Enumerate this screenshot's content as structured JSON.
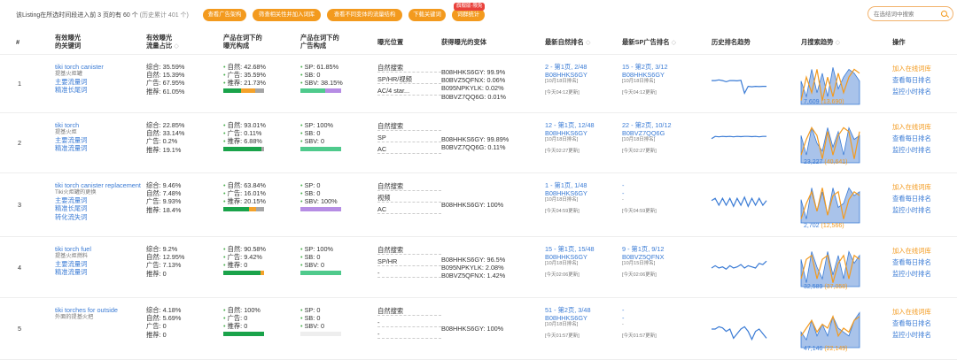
{
  "toolbar": {
    "summary": "该Listing在所选时间段进入前 3 页的有 60 个",
    "history": "(历史累计 401 个)",
    "buttons": [
      "查看广告架构",
      "筛查相关性并加入词库",
      "查看不同变体的流量结构",
      "下载关键词",
      "词群统计"
    ],
    "badge": "旗舰版·限免",
    "search_placeholder": "在选结词中搜索"
  },
  "headers": {
    "num": "#",
    "kw_l1": "有效曝光",
    "kw_l2": "的关键词",
    "share_l1": "有效曝光",
    "share_l2": "流量占比",
    "comp_l1": "产品在词下的",
    "comp_l2": "曝光构成",
    "adcomp_l1": "产品在词下的",
    "adcomp_l2": "广告构成",
    "pos": "曝光位置",
    "var": "获得曝光的变体",
    "nat": "最新自然排名",
    "sp": "最新SP广告排名",
    "trend": "历史排名趋势",
    "month": "月搜索趋势",
    "act": "操作"
  },
  "actions": {
    "add": "加入在线词库",
    "daily": "查看每日排名",
    "hourly": "监控小时排名"
  },
  "colors": {
    "accent": "#f39a1e",
    "link": "#3a7bd5",
    "natural": "#1aa34a",
    "ad": "#f4a22a",
    "rec": "#a6a6a6",
    "sp": "#4fca8c",
    "sb": "#c7c7c7",
    "sbv": "#b68de4"
  },
  "rows": [
    {
      "num": "1",
      "kw": "tiki torch canister",
      "cn": "提基火炬罐",
      "links": [
        "主要流量词",
        "精准长尾词"
      ],
      "share": [
        "综合: 35.59%",
        "自然: 15.39%",
        "广告: 67.95%",
        "推荐: 61.05%"
      ],
      "comp": [
        "自然: 42.68%",
        "广告: 35.59%",
        "推荐: 21.73%"
      ],
      "comp_vals": [
        42.68,
        35.59,
        21.73
      ],
      "adcomp": [
        "SP: 61.85%",
        "SB: 0",
        "SBV: 38.15%"
      ],
      "adcomp_vals": [
        61.85,
        0,
        38.15
      ],
      "pos": [
        "自然搜索",
        "SP/HR/视频",
        "AC/4 star..."
      ],
      "var": [
        "B08HHKS6GY: 99.9%",
        "B0BVZ5QFNX: 0.06%",
        "B095NPKYLK: 0.02%",
        "B0BVZ7QQ6G: 0.01%"
      ],
      "nat": [
        "2 - 第1页, 2/48",
        "B08HHKS6GY",
        "[10月18日排名]",
        "[今天04:12更新]"
      ],
      "sp": [
        "15 - 第2页, 3/12",
        "B08HHKS6GY",
        "[10月18日排名]",
        "[今天04:12更新]"
      ],
      "month_label": [
        "7,609",
        "13,690"
      ]
    },
    {
      "num": "2",
      "kw": "tiki torch",
      "cn": "提基火炬",
      "links": [
        "主要流量词",
        "精准流量词"
      ],
      "share": [
        "综合: 22.85%",
        "自然: 33.14%",
        "广告: 0.2%",
        "推荐: 19.1%"
      ],
      "comp": [
        "自然: 93.01%",
        "广告: 0.11%",
        "推荐: 6.88%"
      ],
      "comp_vals": [
        93.01,
        0.11,
        6.88
      ],
      "adcomp": [
        "SP: 100%",
        "SB: 0",
        "SBV: 0"
      ],
      "adcomp_vals": [
        100,
        0,
        0
      ],
      "pos": [
        "自然搜索",
        "SP",
        "AC"
      ],
      "var": [
        "B08HHKS6GY: 99.89%",
        "B0BVZ7QQ6G: 0.11%"
      ],
      "nat": [
        "12 - 第1页, 12/48",
        "B08HHKS6GY",
        "[10月18日排名]",
        "[今天02:27更新]"
      ],
      "sp": [
        "22 - 第2页, 10/12",
        "B0BVZ7QQ6G",
        "[10月18日排名]",
        "[今天02:27更新]"
      ],
      "month_label": [
        "23,227",
        "40,641"
      ]
    },
    {
      "num": "3",
      "kw": "tiki torch canister replacement",
      "cn": "Tiki火炬罐的更换",
      "links": [
        "主要流量词",
        "精准长尾词",
        "转化流失词"
      ],
      "share": [
        "综合: 9.46%",
        "自然: 7.48%",
        "广告: 9.93%",
        "推荐: 18.4%"
      ],
      "comp": [
        "自然: 63.84%",
        "广告: 16.01%",
        "推荐: 20.15%"
      ],
      "comp_vals": [
        63.84,
        16.01,
        20.15
      ],
      "adcomp": [
        "SP: 0",
        "SB: 0",
        "SBV: 100%"
      ],
      "adcomp_vals": [
        0,
        0,
        100
      ],
      "pos": [
        "自然搜索",
        "视频",
        "AC"
      ],
      "var": [
        "B08HHKS6GY: 100%"
      ],
      "nat": [
        "1 - 第1页, 1/48",
        "B08HHKS6GY",
        "[10月18日排名]",
        "[今天04:59更新]"
      ],
      "sp": [
        "-",
        "-",
        "-",
        "[今天04:59更新]"
      ],
      "month_label": [
        "2,702",
        "12,566"
      ]
    },
    {
      "num": "4",
      "kw": "tiki torch fuel",
      "cn": "提基火炬燃料",
      "links": [
        "主要流量词",
        "精准流量词"
      ],
      "share": [
        "综合: 9.2%",
        "自然: 12.95%",
        "广告: 7.13%",
        "推荐: 0"
      ],
      "comp": [
        "自然: 90.58%",
        "广告: 9.42%",
        "推荐: 0"
      ],
      "comp_vals": [
        90.58,
        9.42,
        0
      ],
      "adcomp": [
        "SP: 100%",
        "SB: 0",
        "SBV: 0"
      ],
      "adcomp_vals": [
        100,
        0,
        0
      ],
      "pos": [
        "自然搜索",
        "SP/HR",
        "-"
      ],
      "var": [
        "B08HHKS6GY: 96.5%",
        "B095NPKYLK: 2.08%",
        "B0BVZ5QFNX: 1.42%"
      ],
      "nat": [
        "15 - 第1页, 15/48",
        "B08HHKS6GY",
        "[10月18日排名]",
        "[今天02:06更新]"
      ],
      "sp": [
        "9 - 第1页, 9/12",
        "B0BVZ5QFNX",
        "[10月15日排名]",
        "[今天02:06更新]"
      ],
      "month_label": [
        "32,589",
        "37,058"
      ]
    },
    {
      "num": "5",
      "kw": "tiki torches for outside",
      "cn": "外面的提基火把",
      "links": [],
      "share": [
        "综合: 4.18%",
        "自然: 5.69%",
        "广告: 0",
        "推荐: 0"
      ],
      "comp": [
        "自然: 100%",
        "广告: 0",
        "推荐: 0"
      ],
      "comp_vals": [
        100,
        0,
        0
      ],
      "adcomp": [
        "SP: 0",
        "SB: 0",
        "SBV: 0"
      ],
      "adcomp_vals": [
        0,
        0,
        0
      ],
      "pos": [
        "自然搜索",
        "-",
        "-"
      ],
      "var": [
        "B08HHKS6GY: 100%"
      ],
      "nat": [
        "51 - 第2页, 3/48",
        "B08HHKS6GY",
        "[10月18日排名]",
        "[今天01:57更新]"
      ],
      "sp": [
        "-",
        "-",
        "-",
        "[今天01:57更新]"
      ],
      "month_label": [
        "47,146",
        "22,149"
      ]
    }
  ]
}
